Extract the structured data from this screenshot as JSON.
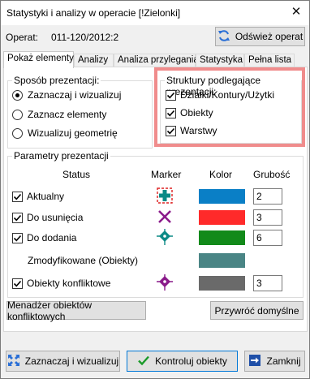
{
  "window": {
    "title": "Statystyki i analizy w operacie [!Zielonki]",
    "close_glyph": "✕"
  },
  "operat": {
    "label": "Operat:",
    "value": "011-120/2012:2",
    "refresh_label": "Odśwież operat"
  },
  "tabs": [
    {
      "label": "Pokaż elementy",
      "active": true
    },
    {
      "label": "Analizy"
    },
    {
      "label": "Analiza przylegania"
    },
    {
      "label": "Statystyka"
    },
    {
      "label": "Pełna lista"
    }
  ],
  "presentation_mode": {
    "title": "Sposób prezentacji:",
    "options": [
      {
        "label": "Zaznaczaj i wizualizuj",
        "checked": true
      },
      {
        "label": "Zaznacz elementy",
        "checked": false
      },
      {
        "label": "Wizualizuj geometrię",
        "checked": false
      }
    ]
  },
  "structures": {
    "title": "Struktury podlegające prezentacji:",
    "items": [
      {
        "label": "Działki/Kontury/Użytki",
        "checked": true
      },
      {
        "label": "Obiekty",
        "checked": true
      },
      {
        "label": "Warstwy",
        "checked": true
      }
    ]
  },
  "params": {
    "title": "Parametry prezentacji",
    "headers": {
      "status": "Status",
      "marker": "Marker",
      "color": "Kolor",
      "thickness": "Grubość"
    },
    "rows": [
      {
        "label": "Aktualny",
        "checked": true,
        "marker_icon": "teal-plus-icon",
        "color": "#0a7fc6",
        "thickness": "2"
      },
      {
        "label": "Do usunięcia",
        "checked": true,
        "marker_icon": "purple-x-icon",
        "color": "#ff2a2a",
        "thickness": "3"
      },
      {
        "label": "Do dodania",
        "checked": true,
        "marker_icon": "teal-diamond-icon",
        "color": "#128a1a",
        "thickness": "6"
      },
      {
        "label": "Zmodyfikowane (Obiekty)",
        "checked": false,
        "marker_icon": "",
        "color": "#4a8585",
        "thickness": ""
      },
      {
        "label": "Obiekty konfliktowe",
        "checked": true,
        "marker_icon": "purple-diamond-icon",
        "color": "#6a6a6a",
        "thickness": "3"
      }
    ]
  },
  "panel_buttons": {
    "conflict_manager": "Menadżer obiektów konfliktowych",
    "restore_defaults": "Przywróć domyślne"
  },
  "footer": {
    "select_visualize": "Zaznaczaj i wizualizuj",
    "check_objects": "Kontroluj obiekty",
    "close": "Zamknij"
  }
}
